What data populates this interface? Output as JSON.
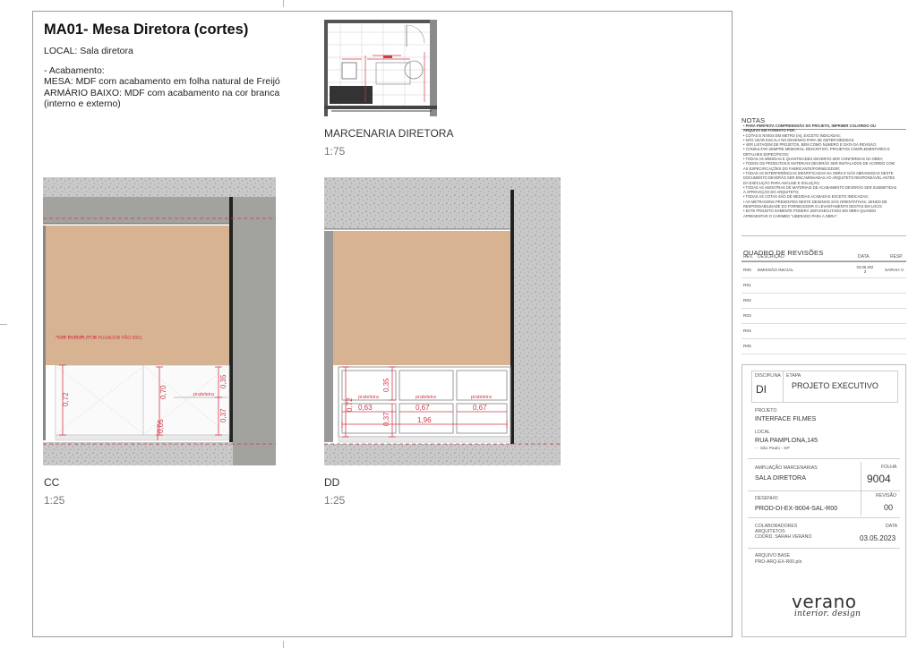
{
  "sheet": {
    "title": "MA01- Mesa Diretora (cortes)",
    "local": "LOCAL: Sala diretora",
    "acabamento": [
      "- Acabamento:",
      "MESA: MDF com acabamento em folha natural de Freijó",
      "ARMÁRIO BAIXO: MDF com acabamento na cor branca",
      "(interno e externo)"
    ]
  },
  "views": {
    "plan": {
      "label": "MARCENARIA DIRETORA",
      "scale": "1:75"
    },
    "cc": {
      "label": "CC",
      "scale": "1:25",
      "note": "VER EXEMPLO DE PUXADOR PÃO 9001",
      "dims": [
        "0,72",
        "0,70",
        "0,35",
        "0,37",
        "0,05"
      ],
      "shelf": "prateleira"
    },
    "dd": {
      "label": "DD",
      "scale": "1:25",
      "dims": [
        "0,72",
        "0,35",
        "0,37",
        "0,63",
        "0,67",
        "0,67",
        "1,96"
      ],
      "shelf": "prateleira"
    }
  },
  "notes": {
    "title": "NOTAS",
    "items": [
      "• PARA PERFEITA COMPREENSÃO DO PROJETO, IMPRIMIR COLORIDO OU",
      "  ARQUIVO EM FORMATO PDF;",
      "• COTAS E NÍVEIS EM METRO (m), EXCETO INDICADAS;",
      "• NÃO USAR ESCALA NO DESENHO PARA SE OBTER MEDIDAS;",
      "• VER LISTAGEM DE PROJETOS, BEM COMO NÚMERO E DATA DA REVISÃO;",
      "• CONSULTAR SEMPRE MEMORIAL DESCRITIVO, PROJETOS COMPLEMENTARES E",
      "  DETALHES ESPECÍFICOS;",
      "• TODAS AS MEDIDAS E QUANTIDADES DEVERÃO SER CONFERIDAS NA OBRA;",
      "• TODOS OS PRODUTOS E MATERIAIS DEVERÃO SER INSTALADOS DE ACORDO COM",
      "  AS ESPECIFICAÇÕES DO FABRICANTE/FORNECEDOR;",
      "• TODAS AS INTERFERÊNCIAS IDENTIFICADAS NA OBRA E NÃO ABRANGIDAS NESTE",
      "  DOCUMENTO DEVERÃO SER ENCAMINHADAS AO ARQUITETO RESPONSÁVEL ANTES",
      "  DA EXECUÇÃO PARA ANÁLISE E SOLUÇÃO;",
      "• TODAS AS AMOSTRAS DE MATERIAIS DE ACABAMENTO DEVERÃO SER SUBMETIDAS",
      "  À APROVAÇÃO DO ARQUITETO;",
      "• TODAS AS COTAS SÃO DE MEDIDAS ACABADAS EXCETO INDICADAS;",
      "• AS METRAGENS PRESENTES NESTE DESENHO SÃO ORIENTATIVAS, SENDO DE",
      "  RESPONSABILIDADE DO FORNECEDOR O LEVANTAMENTO DESTAS EM LOCO;",
      "• ESTE PROJETO SOMENTE PODERÁ SER EXECUTADO EM OBRA QUANDO",
      "  APRESENTAR O CARIMBO \"LIBERADO PARA A OBRA\"."
    ]
  },
  "revisions": {
    "title": "QUADRO DE REVISÕES",
    "col_rev": "REV.",
    "col_desc": "DESCRIÇÃO",
    "col_date": "DATA",
    "col_resp": "RESP.",
    "rows": [
      {
        "rev": "R00",
        "desc": "EMISSÃO INICIAL",
        "date": "03.05.202 3",
        "resp": "SARAH V."
      },
      {
        "rev": "R01",
        "desc": "",
        "date": "",
        "resp": ""
      },
      {
        "rev": "R02",
        "desc": "",
        "date": "",
        "resp": ""
      },
      {
        "rev": "R03",
        "desc": "",
        "date": "",
        "resp": ""
      },
      {
        "rev": "R04",
        "desc": "",
        "date": "",
        "resp": ""
      },
      {
        "rev": "R05",
        "desc": "",
        "date": "",
        "resp": ""
      }
    ]
  },
  "titleblock": {
    "disciplina_label": "DISCIPLINA",
    "disciplina": "DI",
    "etapa_label": "ETAPA",
    "etapa": "PROJETO EXECUTIVO",
    "projeto_label": "PROJETO",
    "projeto": "INTERFACE FILMES",
    "local_label": "LOCAL",
    "local": "RUA PAMPLONA,145",
    "cidade": "- - São Paulo - SP",
    "ampliacao_label": "AMPLIAÇÃO MARCENARIAS",
    "ampliacao": "SALA DIRETORA",
    "folha_label": "FOLHA",
    "folha": "9004",
    "desenho_label": "DESENHO",
    "desenho": "PROD-DI-EX-9004-SAL-R00",
    "revisao_label": "REVISÃO",
    "revisao": "00",
    "colab_label": "COLABORADORES",
    "arq_label": "ARQUITETOS",
    "coord": "COORD. SARAH VERANO",
    "data_label": "DATA",
    "data": "03.05.2023",
    "arquivo_label": "ARQUIVO BASE",
    "arquivo": "PRO-ARQ-EX-R00.pln",
    "logo": "verano",
    "logo_sub": "interior. design"
  },
  "colors": {
    "wood": "#d8b392",
    "concrete": "#c6c6c6",
    "dim_red": "#d23a4a",
    "cabinet": "#ffffff"
  }
}
